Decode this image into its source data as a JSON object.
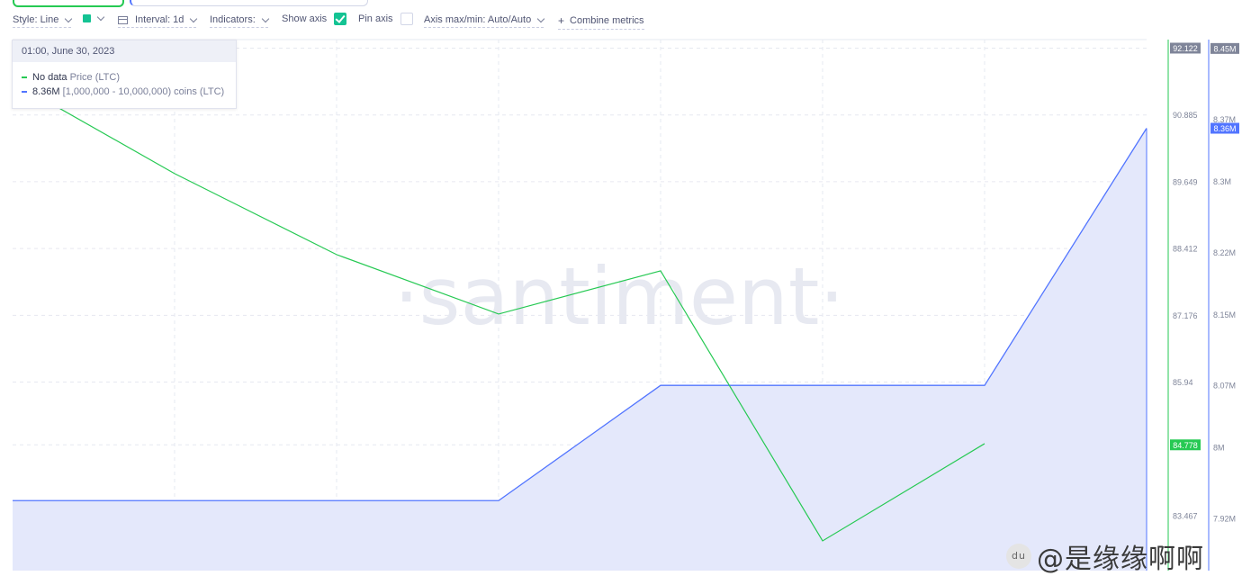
{
  "toolbar": {
    "style_label": "Style: Line",
    "interval_label": "Interval: 1d",
    "indicators_label": "Indicators:",
    "show_axis_label": "Show axis",
    "pin_axis_label": "Pin axis",
    "axis_minmax_label": "Axis max/min: Auto/Auto",
    "combine_label": "Combine metrics",
    "swatch_color": "#14c393",
    "show_axis_checked": true,
    "pin_axis_checked": false
  },
  "tooltip": {
    "date": "01:00, June 30, 2023",
    "rows": [
      {
        "value": "No data",
        "label": "Price (LTC)",
        "color": "#26c953"
      },
      {
        "value": "8.36M",
        "label": "[1,000,000 - 10,000,000) coins (LTC)",
        "color": "#5275ff"
      }
    ]
  },
  "watermark": {
    "text": "·santiment·",
    "credit": "@是缘缘啊啊",
    "credit_icon": "du"
  },
  "chart_data": {
    "type": "line",
    "grid": true,
    "series": [
      {
        "name": "Price (LTC)",
        "color": "#26c953",
        "values": [
          91.5,
          89.8,
          88.3,
          87.2,
          88.0,
          83.0,
          84.8,
          null
        ],
        "last_value_label": "84.776",
        "axis_range": [
          82.35,
          92.28
        ],
        "axis_ticks": [
          "92.122",
          "90.885",
          "89.649",
          "88.412",
          "87.176",
          "85.94",
          "84.778",
          "83.467"
        ],
        "axis_tick_values": [
          92.122,
          90.885,
          89.649,
          88.412,
          87.176,
          85.94,
          84.778,
          83.467
        ]
      },
      {
        "name": "[1,000,000 - 10,000,000) coins (LTC)",
        "color": "#5275ff",
        "fill": "#e4e8fb",
        "values": [
          7.94,
          7.94,
          7.94,
          7.94,
          8.07,
          8.07,
          8.07,
          8.36
        ],
        "last_value_label": "8.36M",
        "axis_range": [
          7.855,
          8.46
        ],
        "axis_ticks": [
          "8.45M",
          "8.37M",
          "8.3M",
          "8.22M",
          "8.15M",
          "8.07M",
          "8M",
          "7.92M"
        ],
        "axis_tick_values": [
          8.45,
          8.37,
          8.3,
          8.22,
          8.15,
          8.07,
          8.0,
          7.92
        ]
      }
    ],
    "highlighted_ticks": [
      {
        "series": 0,
        "label": "92.122",
        "color": "#7f8599"
      },
      {
        "series": 0,
        "label": "84.778",
        "color": "#26c953"
      },
      {
        "series": 1,
        "label": "8.45M",
        "color": "#7f8599"
      },
      {
        "series": 1,
        "label": "8.36M",
        "color": "#5275ff"
      }
    ]
  }
}
